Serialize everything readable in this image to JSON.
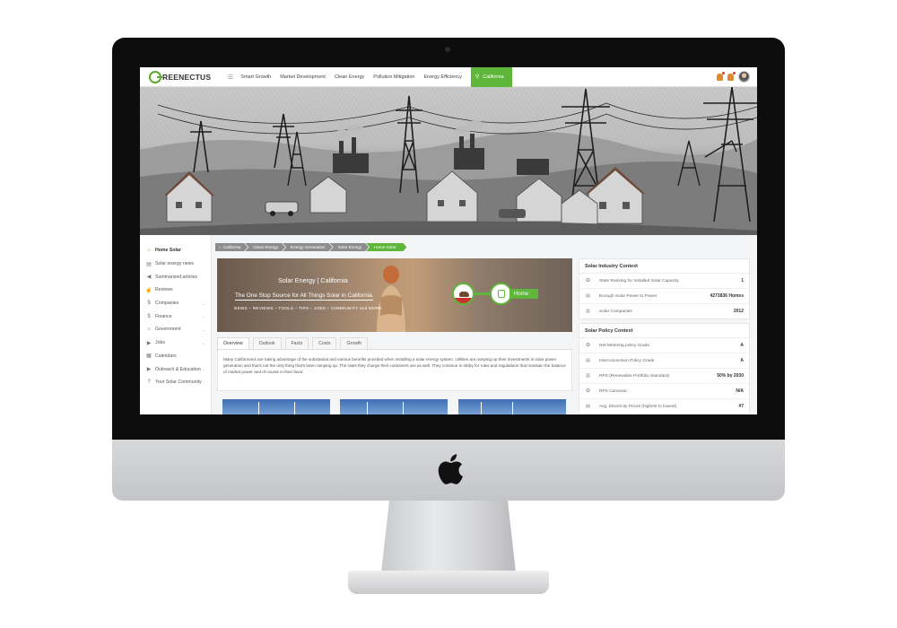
{
  "nav": {
    "logo_text": "REENECTUS",
    "items": [
      {
        "label": "Smart Growth"
      },
      {
        "label": "Market Development"
      },
      {
        "label": "Clean Energy"
      },
      {
        "label": "Pollution Mitigation"
      },
      {
        "label": "Energy Efficiency"
      }
    ],
    "active_item": "California",
    "accent_color": "#5eb63a"
  },
  "sidebar": {
    "items": [
      {
        "label": "Home Solar",
        "icon": "home-icon"
      },
      {
        "label": "Solar energy news",
        "icon": "news-icon"
      },
      {
        "label": "Summarized articles",
        "icon": "megaphone-icon"
      },
      {
        "label": "Reviews",
        "icon": "thumbs-icon"
      },
      {
        "label": "Companies",
        "icon": "dollar-icon"
      },
      {
        "label": "Finance",
        "icon": "dollar-icon"
      },
      {
        "label": "Government",
        "icon": "bank-icon"
      },
      {
        "label": "Jobs",
        "icon": "play-icon"
      },
      {
        "label": "Calendars",
        "icon": "calendar-icon"
      },
      {
        "label": "Outreach & Education",
        "icon": "play-icon"
      },
      {
        "label": "Your Solar Community",
        "icon": "question-icon"
      }
    ]
  },
  "breadcrumbs": [
    "California",
    "Clean Energy",
    "Energy Generation",
    "Solar Energy",
    "Home Solar"
  ],
  "banner": {
    "title": "Solar Energy | California",
    "subtitle": "The One Stop Source for All Things Solar in California.",
    "links": "NEWS – REVIEWS – TOOLS – TIPS – JOBS – COMMUNITY and MORE",
    "home_label": "Home"
  },
  "tabs": [
    "Overview",
    "Outlook",
    "Facts",
    "Costs",
    "Growth"
  ],
  "overview_text": "Many Californians are taking advantage of the substantial and various benefits provided when installing a solar energy system. Utilities are ramping up their investments in solar power generation and that's not the only thing that's been ramping up. The rates they charge their customers are as well. They continue to lobby for rules and regulations that maintain the balance of market power and of course in their favor.",
  "industry_context": {
    "title": "Solar Industry Context",
    "rows": [
      {
        "label": "State Ranking for Installed Solar Capacity",
        "value": "1",
        "icon": "award-icon"
      },
      {
        "label": "Enough Solar Power to Power",
        "value": "4273836 Homes",
        "icon": "doc-icon"
      },
      {
        "label": "Solar Companies",
        "value": "2012",
        "icon": "chart-icon"
      }
    ]
  },
  "policy_context": {
    "title": "Solar Policy Context",
    "rows": [
      {
        "label": "Net-Metering policy Grade",
        "value": "A",
        "icon": "award-icon"
      },
      {
        "label": "Interconnection Policy Grade",
        "value": "A",
        "icon": "doc-icon"
      },
      {
        "label": "RPS (Renewable Portfolio Standard)",
        "value": "50% by 2030",
        "icon": "chart-icon"
      },
      {
        "label": "RPS Carveout",
        "value": "N/A",
        "icon": "award-icon"
      },
      {
        "label": "Avg. Electricity Prices (highest to lowest)",
        "value": "#7",
        "icon": "doc-icon"
      }
    ]
  }
}
